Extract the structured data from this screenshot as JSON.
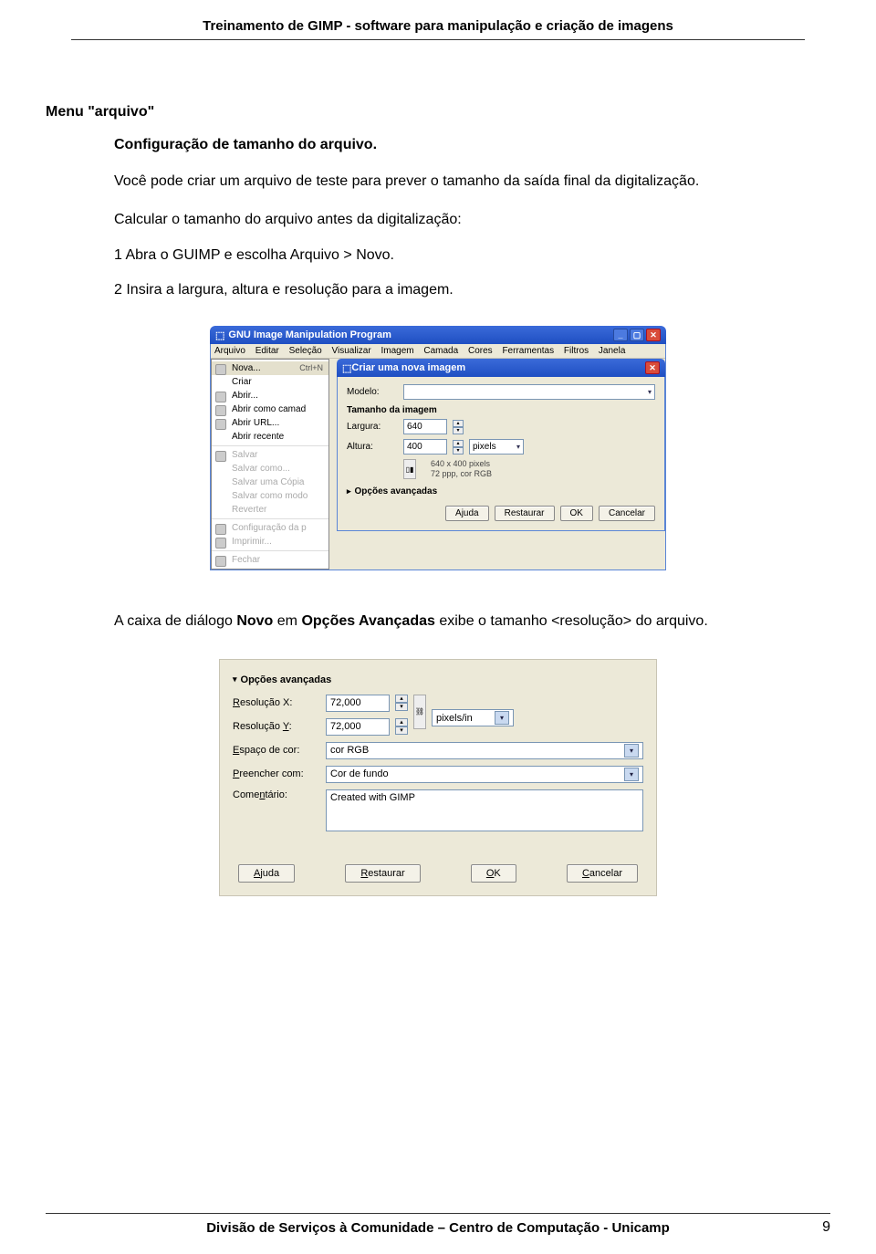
{
  "header": {
    "title": "Treinamento de GIMP - software para manipulação e criação de imagens"
  },
  "section_title": "Menu \"arquivo\"",
  "subtitle": "Configuração de tamanho do arquivo.",
  "para1": "Você pode criar um arquivo de teste para prever o tamanho da saída final da digitalização.",
  "para2": "Calcular o tamanho do arquivo antes da digitalização:",
  "step1": "1  Abra o GUIMP e escolha Arquivo > Novo.",
  "step2": "2  Insira a largura, altura e resolução para a imagem.",
  "para3_pre": "A caixa de diálogo ",
  "para3_bold1": "Novo",
  "para3_mid": " em ",
  "para3_bold2": "Opções Avançadas",
  "para3_post": " exibe o tamanho <resolução> do arquivo.",
  "ss1": {
    "app_title": "GNU Image Manipulation Program",
    "menus": [
      "Arquivo",
      "Editar",
      "Seleção",
      "Visualizar",
      "Imagem",
      "Camada",
      "Cores",
      "Ferramentas",
      "Filtros",
      "Janela"
    ],
    "dropdown": [
      {
        "label": "Nova...",
        "shortcut": "Ctrl+N",
        "sel": true
      },
      {
        "label": "Criar"
      },
      {
        "label": "Abrir..."
      },
      {
        "label": "Abrir como camad"
      },
      {
        "label": "Abrir URL..."
      },
      {
        "label": "Abrir recente"
      },
      {
        "sep": true
      },
      {
        "label": "Salvar",
        "disabled": true
      },
      {
        "label": "Salvar como...",
        "disabled": true
      },
      {
        "label": "Salvar uma Cópia",
        "disabled": true
      },
      {
        "label": "Salvar como modo",
        "disabled": true
      },
      {
        "label": "Reverter",
        "disabled": true
      },
      {
        "sep": true
      },
      {
        "label": "Configuração da p",
        "disabled": true
      },
      {
        "label": "Imprimir...",
        "disabled": true
      },
      {
        "sep": true
      },
      {
        "label": "Fechar",
        "disabled": true
      }
    ],
    "dialog": {
      "title": "Criar uma nova imagem",
      "modelo_label": "Modelo:",
      "group_title": "Tamanho da imagem",
      "largura_label": "Largura:",
      "largura_value": "640",
      "altura_label": "Altura:",
      "altura_value": "400",
      "units": "pixels",
      "info_line1": "640 x 400 pixels",
      "info_line2": "72 ppp, cor RGB",
      "advanced": "Opções avançadas",
      "buttons": [
        "Ajuda",
        "Restaurar",
        "OK",
        "Cancelar"
      ]
    }
  },
  "ss2": {
    "advanced": "Opções avançadas",
    "resx_label": "Resolução X:",
    "resx_value": "72,000",
    "resy_label": "Resolução Y:",
    "resy_value": "72,000",
    "res_units": "pixels/in",
    "espaco_label": "Espaço de cor:",
    "espaco_value": "cor RGB",
    "preencher_label": "Preencher com:",
    "preencher_value": "Cor de fundo",
    "comentario_label": "Comentário:",
    "comentario_value": "Created with GIMP",
    "buttons": [
      "Ajuda",
      "Restaurar",
      "OK",
      "Cancelar"
    ]
  },
  "footer": {
    "text": "Divisão de Serviços à Comunidade – Centro de Computação - Unicamp",
    "page": "9"
  }
}
